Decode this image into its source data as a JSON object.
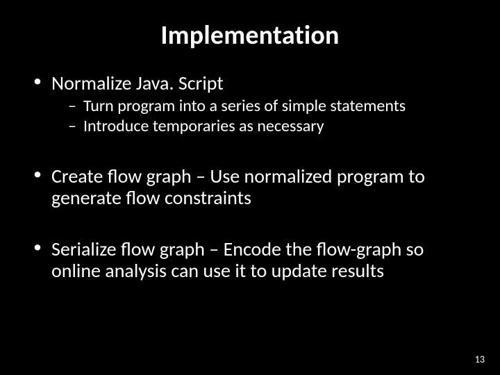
{
  "title": "Implementation",
  "bullets": [
    {
      "text": "Normalize Java. Script",
      "children": [
        "Turn program into a series of simple statements",
        "Introduce temporaries as necessary"
      ]
    },
    {
      "text": "Create flow graph – Use normalized program to generate flow constraints",
      "children": []
    },
    {
      "text": "Serialize flow graph – Encode the flow-graph so online analysis can use it to update results",
      "children": []
    }
  ],
  "page_number": "13"
}
